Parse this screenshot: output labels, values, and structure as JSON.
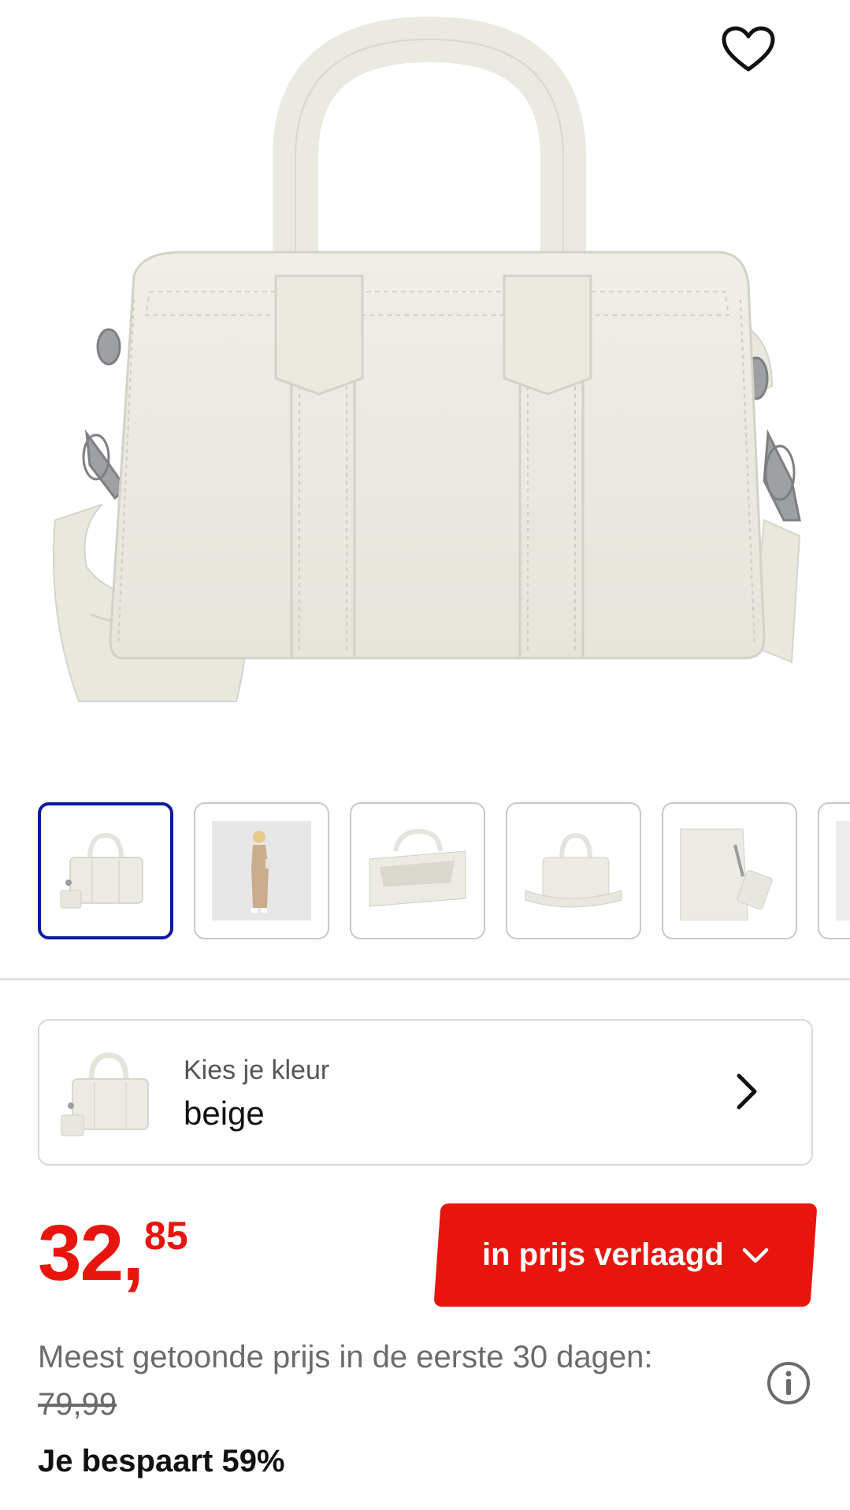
{
  "product": {
    "image_alt": "beige handbag",
    "favorite_icon": "heart-outline-icon"
  },
  "thumbnails": [
    {
      "name": "bag-front",
      "active": true
    },
    {
      "name": "model-wearing",
      "active": false
    },
    {
      "name": "bag-open",
      "active": false
    },
    {
      "name": "bag-angle",
      "active": false
    },
    {
      "name": "bag-side",
      "active": false
    },
    {
      "name": "more",
      "active": false
    }
  ],
  "color_picker": {
    "label": "Kies je kleur",
    "value": "beige",
    "chevron_icon": "chevron-right-icon"
  },
  "price": {
    "main": "32,",
    "cents": "85",
    "color": "#e8150c"
  },
  "badge": {
    "label": "in prijs verlaagd",
    "icon": "chevron-down-icon"
  },
  "info": {
    "text": "Meest getoonde prijs in de eerste 30 dagen:",
    "old_price": "79,99",
    "icon": "info-icon",
    "saving": "Je bespaart 59%"
  },
  "colors": {
    "accent_red": "#e8150c",
    "active_thumb_border": "#0a1aa0",
    "bag_cream": "#ecebe3"
  }
}
